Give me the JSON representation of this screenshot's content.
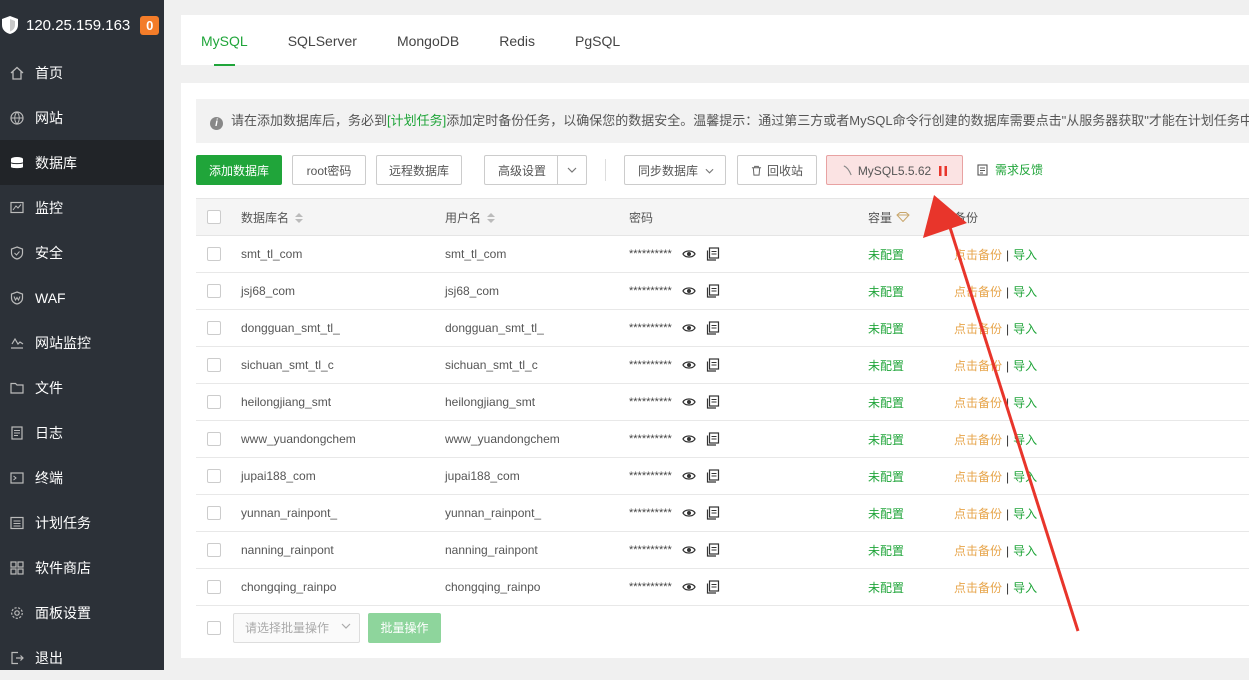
{
  "sidebar": {
    "ip": "120.25.159.163",
    "badge": "0",
    "items": [
      {
        "label": "首页",
        "icon": "home-icon"
      },
      {
        "label": "网站",
        "icon": "globe-icon"
      },
      {
        "label": "数据库",
        "icon": "database-icon"
      },
      {
        "label": "监控",
        "icon": "monitor-icon"
      },
      {
        "label": "安全",
        "icon": "shield-icon"
      },
      {
        "label": "WAF",
        "icon": "waf-shield-icon"
      },
      {
        "label": "网站监控",
        "icon": "pulse-icon"
      },
      {
        "label": "文件",
        "icon": "folder-icon"
      },
      {
        "label": "日志",
        "icon": "log-icon"
      },
      {
        "label": "终端",
        "icon": "terminal-icon"
      },
      {
        "label": "计划任务",
        "icon": "task-list-icon"
      },
      {
        "label": "软件商店",
        "icon": "apps-grid-icon"
      },
      {
        "label": "面板设置",
        "icon": "gear-icon"
      },
      {
        "label": "退出",
        "icon": "logout-icon"
      }
    ],
    "active_index": 2
  },
  "tabs": [
    "MySQL",
    "SQLServer",
    "MongoDB",
    "Redis",
    "PgSQL"
  ],
  "notice": {
    "before": "请在添加数据库后，务必到",
    "link": "[计划任务]",
    "after": "添加定时备份任务，以确保您的数据安全。温馨提示：通过第三方或者MySQL命令行创建的数据库需要点击\"从服务器获取\"才能在计划任务中"
  },
  "toolbar": {
    "add_db": "添加数据库",
    "root_pwd": "root密码",
    "remote_db": "远程数据库",
    "advanced": "高级设置",
    "sync_db": "同步数据库",
    "recycle": "回收站",
    "mysql_version": "MySQL5.5.62",
    "feedback": "需求反馈"
  },
  "table": {
    "headers": {
      "name": "数据库名",
      "user": "用户名",
      "password": "密码",
      "capacity": "容量",
      "backup": "备份"
    },
    "rows": [
      {
        "name": "smt_tl_com",
        "user": "smt_tl_com",
        "password": "**********",
        "capacity": "未配置",
        "backup": "点击备份",
        "import": "导入"
      },
      {
        "name": "jsj68_com",
        "user": "jsj68_com",
        "password": "**********",
        "capacity": "未配置",
        "backup": "点击备份",
        "import": "导入"
      },
      {
        "name": "dongguan_smt_tl_",
        "user": "dongguan_smt_tl_",
        "password": "**********",
        "capacity": "未配置",
        "backup": "点击备份",
        "import": "导入"
      },
      {
        "name": "sichuan_smt_tl_c",
        "user": "sichuan_smt_tl_c",
        "password": "**********",
        "capacity": "未配置",
        "backup": "点击备份",
        "import": "导入"
      },
      {
        "name": "heilongjiang_smt",
        "user": "heilongjiang_smt",
        "password": "**********",
        "capacity": "未配置",
        "backup": "点击备份",
        "import": "导入"
      },
      {
        "name": "www_yuandongchem",
        "user": "www_yuandongchem",
        "password": "**********",
        "capacity": "未配置",
        "backup": "点击备份",
        "import": "导入"
      },
      {
        "name": "jupai188_com",
        "user": "jupai188_com",
        "password": "**********",
        "capacity": "未配置",
        "backup": "点击备份",
        "import": "导入"
      },
      {
        "name": "yunnan_rainpont_",
        "user": "yunnan_rainpont_",
        "password": "**********",
        "capacity": "未配置",
        "backup": "点击备份",
        "import": "导入"
      },
      {
        "name": "nanning_rainpont",
        "user": "nanning_rainpont",
        "password": "**********",
        "capacity": "未配置",
        "backup": "点击备份",
        "import": "导入"
      },
      {
        "name": "chongqing_rainpo",
        "user": "chongqing_rainpo",
        "password": "**********",
        "capacity": "未配置",
        "backup": "点击备份",
        "import": "导入"
      }
    ]
  },
  "footer": {
    "batch_select_placeholder": "请选择批量操作",
    "batch_button": "批量操作"
  },
  "colors": {
    "accent": "#20a53a",
    "sidebar_bg": "#2c3138",
    "backup_link": "#e7a54b",
    "annotation_arrow": "#e8352b"
  }
}
